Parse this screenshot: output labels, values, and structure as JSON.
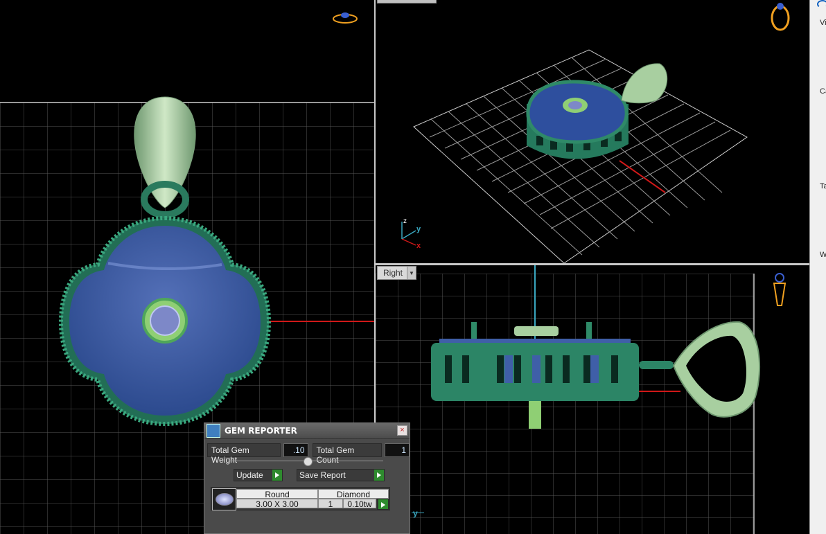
{
  "viewports": {
    "right": {
      "label": "Right"
    },
    "perspective": {
      "axis_z": "z",
      "axis_y": "y",
      "axis_x": "x"
    },
    "right_axis_y": "y"
  },
  "right_panel": {
    "labels": [
      "Vi",
      "Ca",
      "Ta",
      "W"
    ]
  },
  "gem_reporter": {
    "title": "GEM REPORTER",
    "total_weight_label": "Total Gem Weight",
    "total_weight_value": ".10",
    "total_count_label": "Total Gem Count",
    "total_count_value": "1",
    "update_label": "Update",
    "save_report_label": "Save Report",
    "row": {
      "shape": "Round",
      "size": "3.00 X 3.00",
      "type": "Diamond",
      "count": "1",
      "tw": "0.10tw"
    }
  },
  "colors": {
    "metal_green": "#2f8a68",
    "gem_blue": "#3f5fa8",
    "bail_green": "#a8cfa0",
    "grid": "#d8d8d8",
    "axis_red": "#d01818"
  }
}
